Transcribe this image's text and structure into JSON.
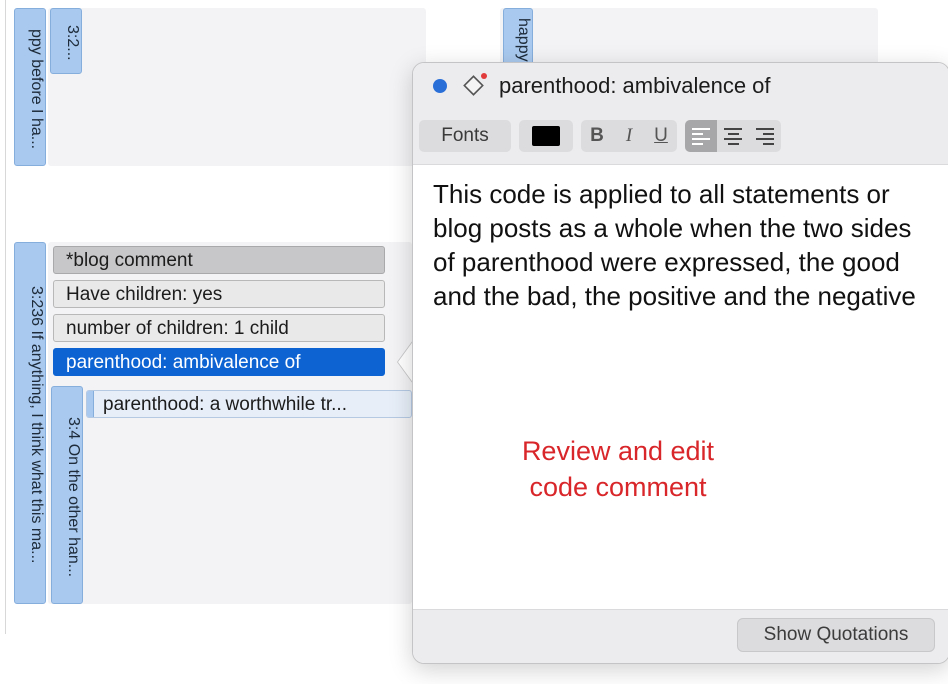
{
  "quotations": {
    "q_top_left": "ppy before I ha...",
    "q_top_id": "3:2...",
    "q_top_right": "happy",
    "q_main": "3:236 If anything, I think what this ma...",
    "q_sub": "3:4 On the other han..."
  },
  "codes": {
    "group": "*blog comment",
    "items": [
      "Have children: yes",
      "number of children: 1 child",
      "parenthood: ambivalence of"
    ],
    "linked": "parenthood: a worthwhile tr..."
  },
  "popover": {
    "title": "parenthood: ambivalence of",
    "toolbar": {
      "fonts_label": "Fonts",
      "bold_label": "B",
      "italic_label": "I",
      "underline_label": "U",
      "text_color": "#000000"
    },
    "comment": "This code is applied to all statements or blog posts as a whole when the two sides of parenthood were expressed, the good and the bad, the positive and the negative",
    "annotation_line1": "Review and edit",
    "annotation_line2": "code comment",
    "show_quotations_label": "Show Quotations"
  },
  "colors": {
    "selection": "#0d63d2",
    "quotation_tag": "#a9c9ee",
    "annotation": "#d8262a",
    "status_dot": "#2a6fd8"
  }
}
